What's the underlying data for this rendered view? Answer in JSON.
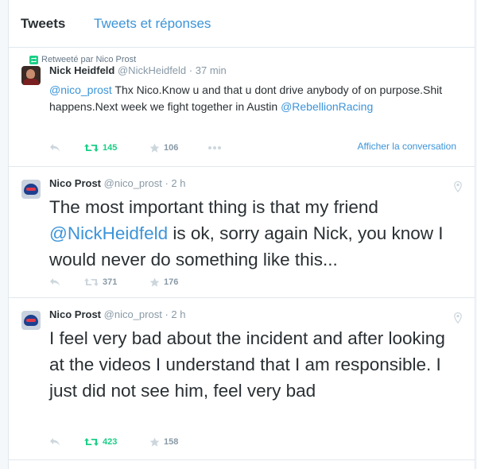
{
  "tabs": {
    "tweets": "Tweets",
    "tweets_replies": "Tweets et réponses"
  },
  "tweets": [
    {
      "context": "Retweeté par Nico Prost",
      "fullname": "Nick Heidfeld",
      "username": "@NickHeidfeld",
      "dot": "·",
      "time": "37 min",
      "mention1": "@nico_prost",
      "text1": " Thx Nico.Know u and that u dont drive anybody of on purpose.Shit happens.Next week we fight together in Austin ",
      "mention2": "@RebellionRacing",
      "retweets": "145",
      "favorites": "106",
      "retweeted": true,
      "show_conversation": "Afficher la conversation"
    },
    {
      "fullname": "Nico Prost",
      "username": "@nico_prost",
      "dot": "·",
      "time": "2 h",
      "text1": "The most important thing is that my friend ",
      "mention1": "@NickHeidfeld",
      "text2": " is ok, sorry again Nick, you know I would never do something like this...",
      "retweets": "371",
      "favorites": "176",
      "retweeted": false
    },
    {
      "fullname": "Nico Prost",
      "username": "@nico_prost",
      "dot": "·",
      "time": "2 h",
      "text1": "I feel very bad about the incident and after looking at the videos I understand that I am responsible. I just did not see him, feel very bad",
      "retweets": "423",
      "favorites": "158",
      "retweeted": true
    }
  ],
  "colors": {
    "link": "#3b94d9",
    "retweet_green": "#19cf86",
    "muted": "#8899a6"
  },
  "icons": [
    "retweet-icon",
    "reply-icon",
    "favorite-icon",
    "more-icon",
    "location-pin-icon"
  ]
}
